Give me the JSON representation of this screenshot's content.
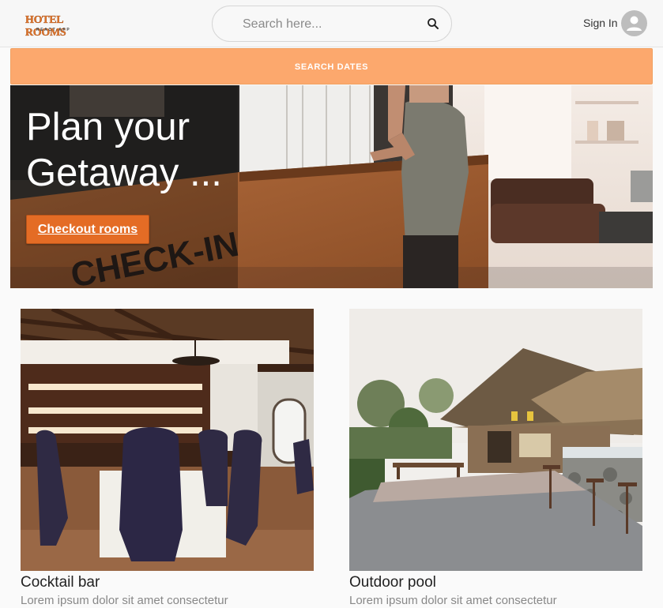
{
  "header": {
    "logo_main": "HOTEL ROOMS",
    "logo_sub": "REACT-APP",
    "search_placeholder": "Search here...",
    "search_icon": "search-icon",
    "signin_label": "Sign In",
    "avatar_icon": "account-circle-icon"
  },
  "dates_bar": {
    "label": "SEARCH DATES",
    "color": "#fca86d"
  },
  "hero": {
    "title_line1": "Plan your",
    "title_line2": "Getaway ...",
    "button_label": "Checkout rooms",
    "button_color": "#e46c25",
    "sign_text": "CHECK-IN"
  },
  "cards": [
    {
      "title": "Cocktail bar",
      "description": "Lorem ipsum dolor sit amet consectetur"
    },
    {
      "title": "Outdoor pool",
      "description": "Lorem ipsum dolor sit amet consectetur"
    }
  ]
}
